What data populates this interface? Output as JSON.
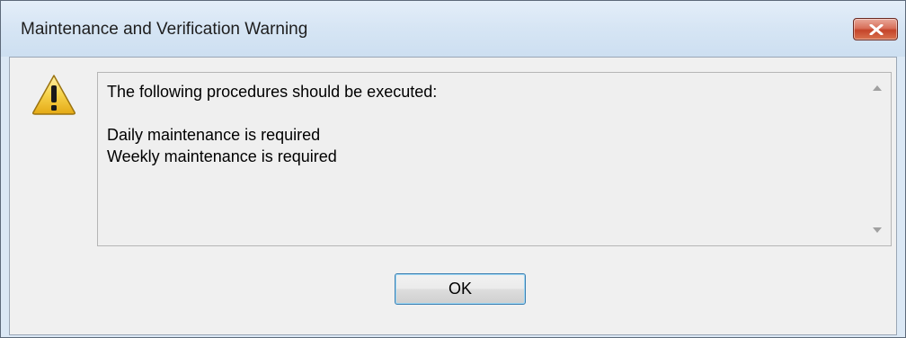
{
  "window": {
    "title": "Maintenance and Verification Warning",
    "close_icon": "close-icon"
  },
  "message": {
    "icon": "warning-icon",
    "lines": [
      "The following procedures should be executed:",
      "",
      "Daily maintenance is required",
      "Weekly maintenance is required"
    ]
  },
  "buttons": {
    "ok_label": "OK"
  },
  "colors": {
    "titlebar": "#dbe8f5",
    "close_button": "#c7452c",
    "warning_icon": "#f2c531"
  }
}
